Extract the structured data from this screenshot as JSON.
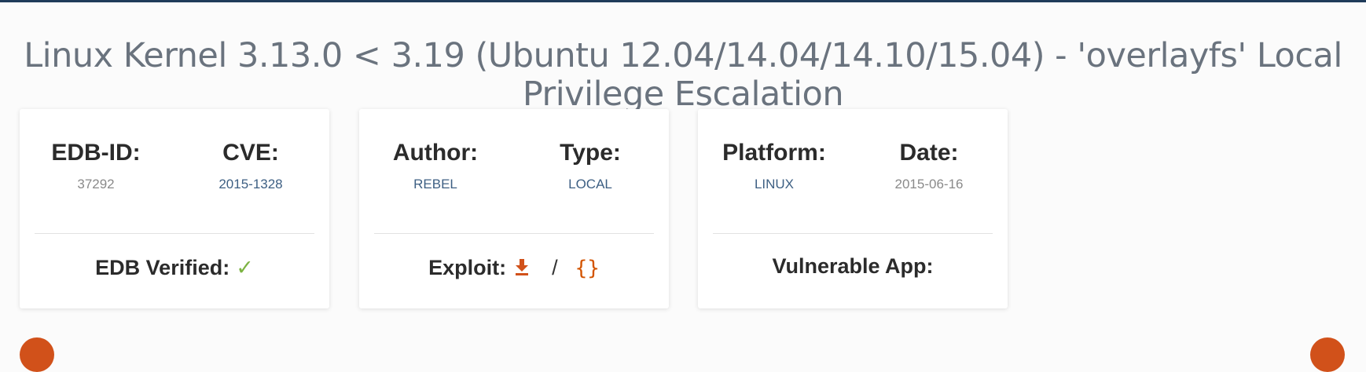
{
  "title": "Linux Kernel 3.13.0 < 3.19 (Ubuntu 12.04/14.04/14.10/15.04) - 'overlayfs' Local Privilege Escalation",
  "cards": [
    {
      "left_label": "EDB-ID:",
      "left_value": "37292",
      "right_label": "CVE:",
      "right_value": "2015-1328",
      "bottom_label": "EDB Verified:",
      "bottom_icon": "checkmark-icon"
    },
    {
      "left_label": "Author:",
      "left_value": "REBEL",
      "right_label": "Type:",
      "right_value": "LOCAL",
      "bottom_label": "Exploit:",
      "bottom_icon": "download-icon",
      "separator": "/",
      "code_glyph": "{}"
    },
    {
      "left_label": "Platform:",
      "left_value": "LINUX",
      "right_label": "Date:",
      "right_value": "2015-06-16",
      "bottom_label": "Vulnerable App:"
    }
  ],
  "colors": {
    "accent": "#d1511a",
    "link_blue": "#3d5f83",
    "verified_green": "#7cb342",
    "title_grey": "#6a737e"
  }
}
